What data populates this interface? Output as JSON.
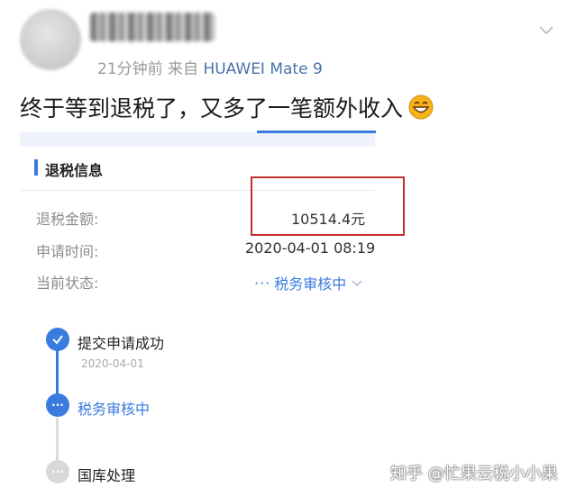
{
  "post": {
    "time_ago": "21分钟前",
    "source_prefix": "来自",
    "device": "HUAWEI Mate 9",
    "content": "终于等到退税了，又多了一笔额外收入"
  },
  "icons": {
    "menu": "chevron-down-icon",
    "emoji": "grinning-face-icon",
    "done": "check-icon",
    "current": "ellipsis-icon"
  },
  "colors": {
    "accent": "#3a7be0",
    "highlight_border": "#c62d2d"
  },
  "refund_card": {
    "section_title": "退税信息",
    "amount_label": "退税金额:",
    "amount_value": "10514.4元",
    "date_label": "申请时间:",
    "date_value": "2020-04-01 08:19",
    "status_label": "当前状态:",
    "status_value": "税务审核中",
    "status_dots": "···"
  },
  "timeline": {
    "step1_label": "提交申请成功",
    "step1_date": "2020-04-01",
    "step2_label": "税务审核中",
    "step2_icon_text": "···",
    "step3_label": "国库处理",
    "step3_icon_text": "···"
  },
  "watermark": "知乎 @忙果云税小小果"
}
